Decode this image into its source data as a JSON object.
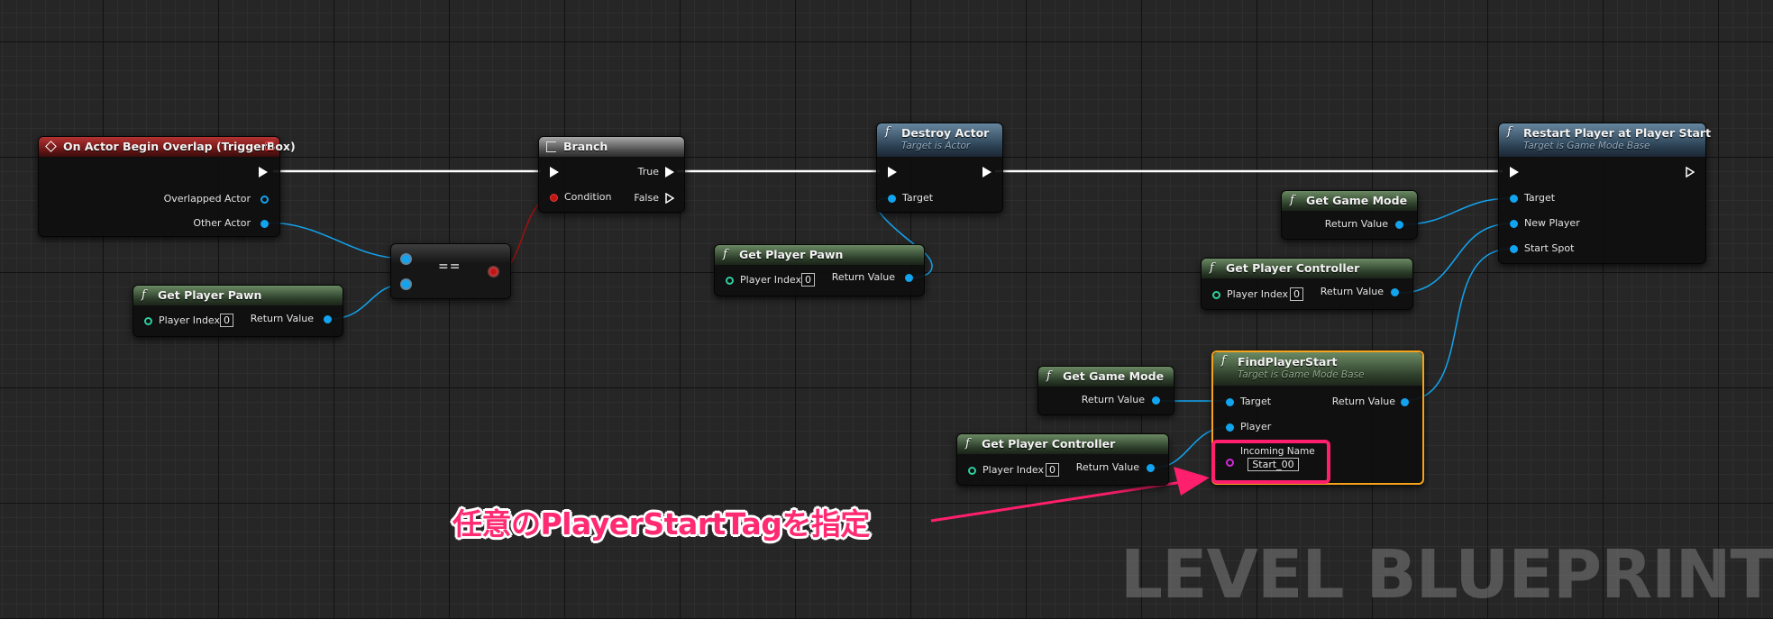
{
  "nodes": {
    "on_actor_begin_overlap": {
      "title": "On Actor Begin Overlap (TriggerBox)",
      "pins": {
        "overlapped_actor": "Overlapped Actor",
        "other_actor": "Other Actor"
      }
    },
    "get_player_pawn_1": {
      "title": "Get Player Pawn",
      "pins": {
        "player_index": "Player Index",
        "player_index_value": "0",
        "return_value": "Return Value"
      }
    },
    "equals": {
      "label": "=="
    },
    "branch": {
      "title": "Branch",
      "pins": {
        "condition": "Condition",
        "true": "True",
        "false": "False"
      }
    },
    "destroy_actor": {
      "title": "Destroy Actor",
      "subtitle": "Target is Actor",
      "pins": {
        "target": "Target"
      }
    },
    "get_player_pawn_2": {
      "title": "Get Player Pawn",
      "pins": {
        "player_index": "Player Index",
        "player_index_value": "0",
        "return_value": "Return Value"
      }
    },
    "restart_player": {
      "title": "Restart Player at Player Start",
      "subtitle": "Target is Game Mode Base",
      "pins": {
        "target": "Target",
        "new_player": "New Player",
        "start_spot": "Start Spot"
      }
    },
    "get_game_mode_1": {
      "title": "Get Game Mode",
      "pins": {
        "return_value": "Return Value"
      }
    },
    "get_player_controller_1": {
      "title": "Get Player Controller",
      "pins": {
        "player_index": "Player Index",
        "player_index_value": "0",
        "return_value": "Return Value"
      }
    },
    "find_player_start": {
      "title": "FindPlayerStart",
      "subtitle": "Target is Game Mode Base",
      "pins": {
        "target": "Target",
        "player": "Player",
        "return_value": "Return Value",
        "incoming_name": "Incoming Name",
        "incoming_name_value": "Start_00"
      }
    },
    "get_game_mode_2": {
      "title": "Get Game Mode",
      "pins": {
        "return_value": "Return Value"
      }
    },
    "get_player_controller_2": {
      "title": "Get Player Controller",
      "pins": {
        "player_index": "Player Index",
        "player_index_value": "0",
        "return_value": "Return Value"
      }
    }
  },
  "annotation": {
    "text": "任意のPlayerStartTagを指定"
  },
  "watermark": {
    "text": "LEVEL BLUEPRINT"
  },
  "colors": {
    "exec_wire": "#ffffff",
    "object_wire": "#12a4ef",
    "bool_wire": "#a01010",
    "annotation": "#ff2a72",
    "selection": "#f7a21b"
  }
}
